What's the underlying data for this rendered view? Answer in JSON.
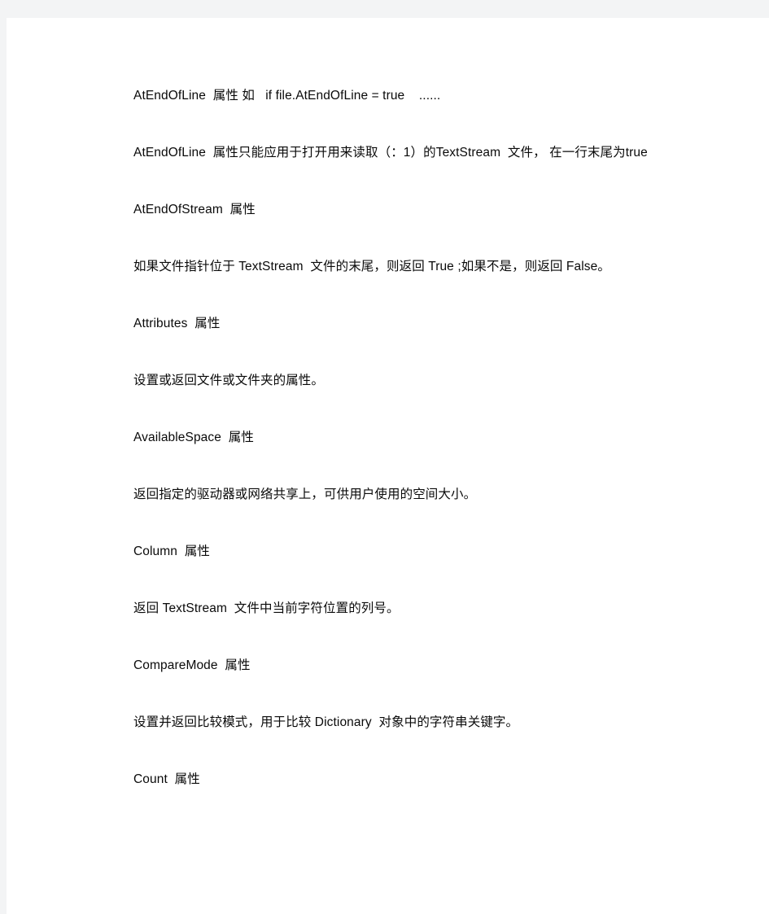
{
  "page": {
    "background_color": "#f3f4f5",
    "sheet_color": "#ffffff",
    "text_color": "#0a0a0a"
  },
  "document": {
    "blocks": [
      {
        "id": "atendofline-summary",
        "kind": "heading",
        "text": "AtEndOfLine  属性 如   if file.AtEndOfLine = true    ......"
      },
      {
        "id": "atendofline-description",
        "kind": "paragraph",
        "text": "AtEndOfLine  属性只能应用于打开用来读取（：1）的TextStream  文件， 在一行末尾为true"
      },
      {
        "id": "atendofstream-heading",
        "kind": "heading",
        "text": "AtEndOfStream  属性"
      },
      {
        "id": "atendofstream-description",
        "kind": "paragraph",
        "text": "如果文件指针位于 TextStream  文件的末尾，则返回 True ;如果不是，则返回 False。"
      },
      {
        "id": "attributes-heading",
        "kind": "heading",
        "text": "Attributes  属性"
      },
      {
        "id": "attributes-description",
        "kind": "paragraph",
        "text": "设置或返回文件或文件夹的属性。"
      },
      {
        "id": "availablespace-heading",
        "kind": "heading",
        "text": "AvailableSpace  属性"
      },
      {
        "id": "availablespace-description",
        "kind": "paragraph",
        "text": "返回指定的驱动器或网络共享上，可供用户使用的空间大小。"
      },
      {
        "id": "column-heading",
        "kind": "heading",
        "text": "Column  属性"
      },
      {
        "id": "column-description",
        "kind": "paragraph",
        "text": "返回 TextStream  文件中当前字符位置的列号。"
      },
      {
        "id": "comparemode-heading",
        "kind": "heading",
        "text": "CompareMode  属性"
      },
      {
        "id": "comparemode-description",
        "kind": "paragraph",
        "text": "设置并返回比较模式，用于比较 Dictionary  对象中的字符串关键字。"
      },
      {
        "id": "count-heading",
        "kind": "heading",
        "text": "Count  属性"
      }
    ]
  }
}
